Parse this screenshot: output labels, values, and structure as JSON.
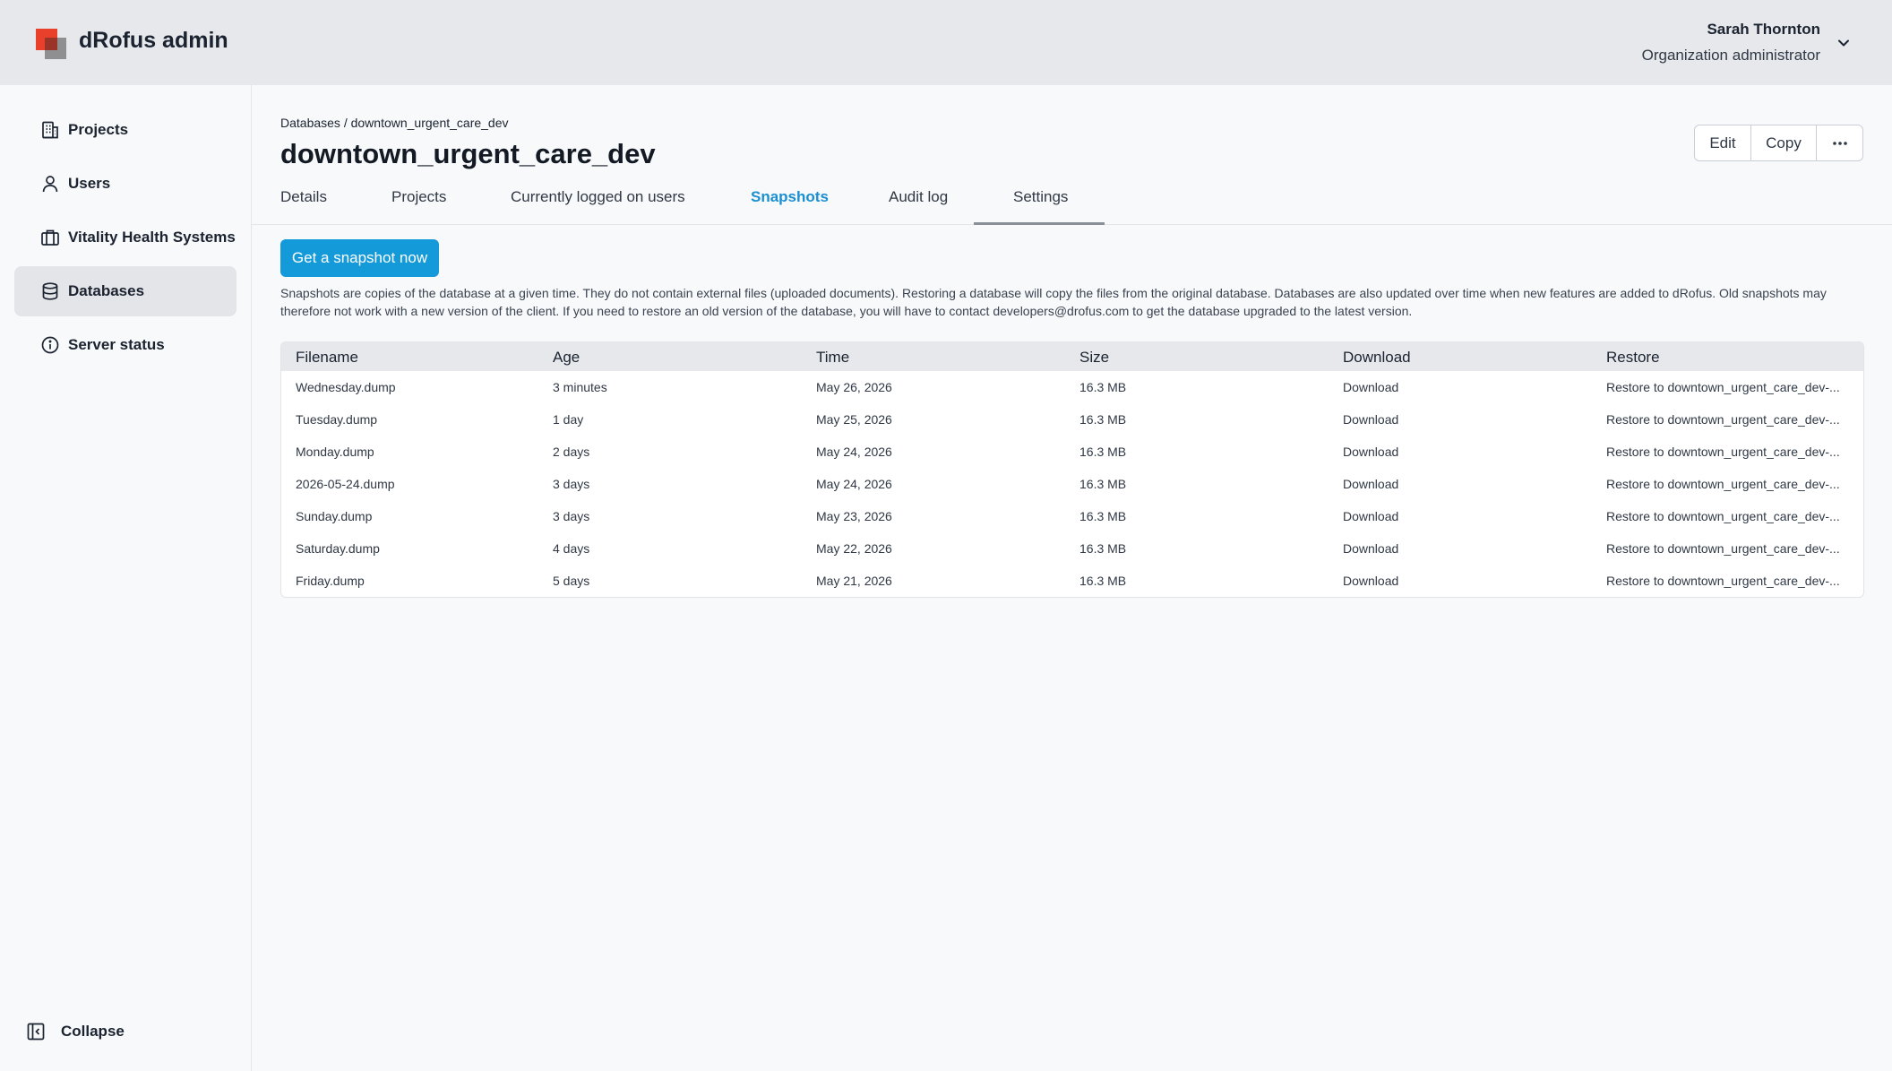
{
  "app": {
    "title": "dRofus admin"
  },
  "user": {
    "name": "Sarah Thornton",
    "role": "Organization administrator"
  },
  "sidebar": {
    "items": [
      {
        "label": "Projects",
        "icon": "building-icon"
      },
      {
        "label": "Users",
        "icon": "user-icon"
      },
      {
        "label": "Vitality Health Systems",
        "icon": "briefcase-icon"
      },
      {
        "label": "Databases",
        "icon": "database-icon",
        "active": true
      },
      {
        "label": "Server status",
        "icon": "info-icon"
      }
    ],
    "collapse_label": "Collapse"
  },
  "breadcrumb": "Databases / downtown_urgent_care_dev",
  "page_title": "downtown_urgent_care_dev",
  "actions": {
    "edit": "Edit",
    "copy": "Copy",
    "more": "⋯"
  },
  "tabs": [
    "Details",
    "Projects",
    "Currently logged on users",
    "Snapshots",
    "Audit log",
    "Settings"
  ],
  "active_tab": "Snapshots",
  "snapshot_button": "Get a snapshot now",
  "info_text": "Snapshots are copies of the database at a given time. They do not contain external files (uploaded documents). Restoring a database will copy the files from the original database. Databases are also updated over time when new features are added to dRofus. Old snapshots may therefore not work with a new version of the client. If you need to restore an old version of the database, you will have to contact developers@drofus.com to get the database upgraded to the latest version.",
  "table": {
    "columns": [
      "Filename",
      "Age",
      "Time",
      "Size",
      "Download",
      "Restore"
    ],
    "rows": [
      {
        "filename": "Wednesday.dump",
        "age": "3 minutes",
        "time": "May 26, 2026",
        "size": "16.3 MB",
        "download": "Download",
        "restore": "Restore to downtown_urgent_care_dev-..."
      },
      {
        "filename": "Tuesday.dump",
        "age": "1 day",
        "time": "May 25, 2026",
        "size": "16.3 MB",
        "download": "Download",
        "restore": "Restore to downtown_urgent_care_dev-..."
      },
      {
        "filename": "Monday.dump",
        "age": "2 days",
        "time": "May 24, 2026",
        "size": "16.3 MB",
        "download": "Download",
        "restore": "Restore to downtown_urgent_care_dev-..."
      },
      {
        "filename": "2026-05-24.dump",
        "age": "3 days",
        "time": "May 24, 2026",
        "size": "16.3 MB",
        "download": "Download",
        "restore": "Restore to downtown_urgent_care_dev-..."
      },
      {
        "filename": "Sunday.dump",
        "age": "3 days",
        "time": "May 23, 2026",
        "size": "16.3 MB",
        "download": "Download",
        "restore": "Restore to downtown_urgent_care_dev-..."
      },
      {
        "filename": "Saturday.dump",
        "age": "4 days",
        "time": "May 22, 2026",
        "size": "16.3 MB",
        "download": "Download",
        "restore": "Restore to downtown_urgent_care_dev-..."
      },
      {
        "filename": "Friday.dump",
        "age": "5 days",
        "time": "May 21, 2026",
        "size": "16.3 MB",
        "download": "Download",
        "restore": "Restore to downtown_urgent_care_dev-..."
      }
    ]
  },
  "colors": {
    "accent": "#149ad9",
    "tab_active": "#1a8fd1",
    "logo_red": "#e8402b"
  }
}
